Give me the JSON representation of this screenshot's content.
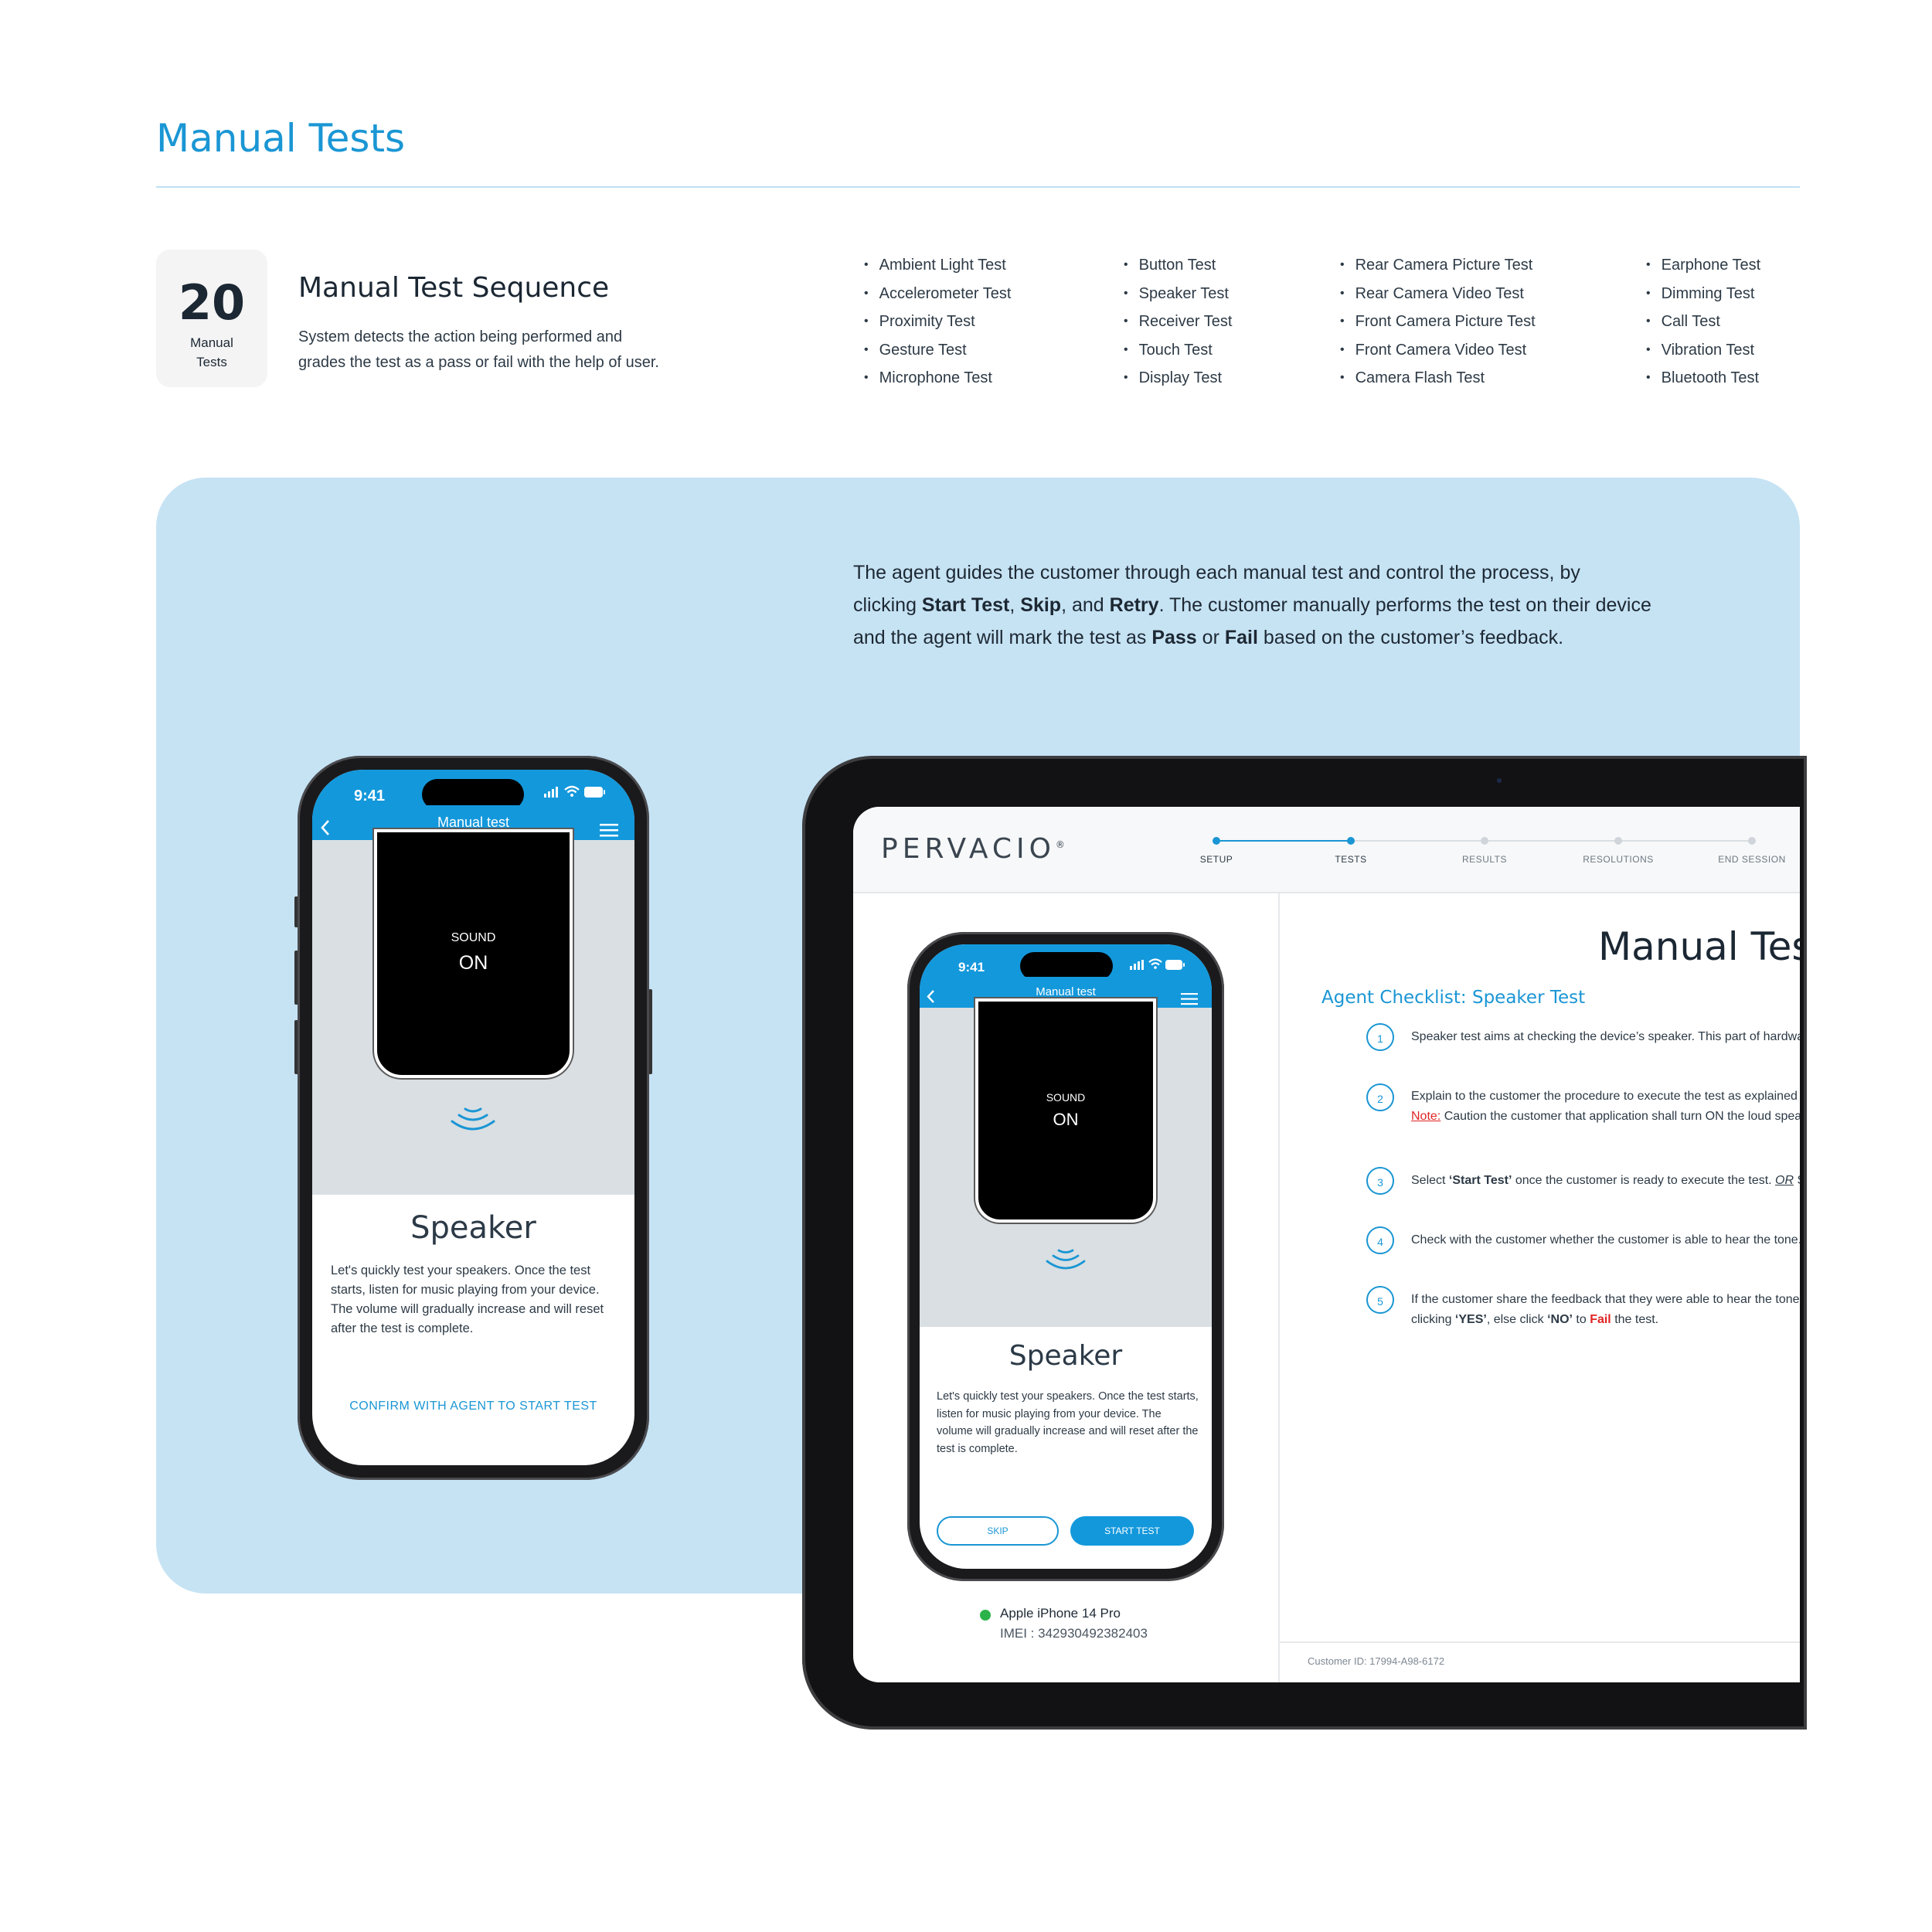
{
  "header": {
    "title": "Manual Tests",
    "count": "20",
    "count_label": "Manual Tests",
    "sequence_title": "Manual Test Sequence",
    "sequence_desc_1": "System detects the action being performed and",
    "sequence_desc_2": "grades the test as a pass or fail with the help of user."
  },
  "tests": {
    "col1": [
      "Ambient Light Test",
      "Accelerometer Test",
      "Proximity Test",
      "Gesture Test",
      "Microphone Test"
    ],
    "col2": [
      "Button Test",
      "Speaker Test",
      "Receiver Test",
      "Touch Test",
      "Display Test"
    ],
    "col3": [
      "Rear Camera Picture Test",
      "Rear Camera Video Test",
      "Front Camera Picture Test",
      "Front Camera Video Test",
      "Camera Flash Test"
    ],
    "col4": [
      "Earphone Test",
      "Dimming Test",
      "Call Test",
      "Vibration Test",
      "Bluetooth Test"
    ]
  },
  "intro": {
    "p1": "The agent guides the customer through each manual test and control the process, by",
    "p2a": "clicking ",
    "p2b": "Start Test",
    "p2c": ", ",
    "p2d": "Skip",
    "p2e": ", and ",
    "p2f": "Retry",
    "p2g": ". The customer manually performs the test on their device",
    "p3a": "and the agent will mark the test as ",
    "p3b": "Pass",
    "p3c": " or ",
    "p3d": "Fail",
    "p3e": " based on the customer’s feedback."
  },
  "phone_customer": {
    "time": "9:41",
    "nav_title": "Manual test",
    "sound_label": "SOUND",
    "sound_state": "ON",
    "test_title": "Speaker",
    "test_desc": "Let's quickly test your speakers. Once the test starts, listen for music playing from your device. The volume will gradually increase and will reset after the test is complete.",
    "cta": "CONFIRM WITH AGENT TO START TEST"
  },
  "agent_app": {
    "logo": "PERVACIO",
    "logo_mark": "®",
    "steps": [
      "SETUP",
      "TESTS",
      "RESULTS",
      "RESOLUTIONS",
      "END SESSION"
    ],
    "active_step_index": 1,
    "phone": {
      "time": "9:41",
      "nav_title": "Manual test",
      "sound_label": "SOUND",
      "sound_state": "ON",
      "test_title": "Speaker",
      "test_desc": "Let's quickly test your speakers. Once the test starts, listen for music playing from your device. The volume will gradually increase and will reset after the test is complete.",
      "skip_label": "SKIP",
      "start_label": "START TEST"
    },
    "device_name": "Apple iPhone 14 Pro",
    "imei_label": "IMEI :",
    "imei": "342930492382403",
    "panel_title": "Manual Test",
    "checklist_title": "Agent Checklist: Speaker Test",
    "checklist": [
      {
        "num": "1",
        "line1": "Speaker test aims at checking the device’s speaker. This part of hardware"
      },
      {
        "num": "2",
        "line1": "Explain to the customer the procedure to execute the test as explained o",
        "note_label": "Note:",
        "note_text": " Caution the customer that application shall turn ON the loud speak"
      },
      {
        "num": "3",
        "pre": "Select ",
        "bold": "‘Start Test’",
        "post": " once the customer is ready to execute the test. ",
        "or": "OR",
        "tail": " Se"
      },
      {
        "num": "4",
        "line1": "Check with the customer whether the customer is able to hear the tone."
      },
      {
        "num": "5",
        "line1": "If the customer share the feedback that they were able to hear the tone c",
        "l2a": "clicking ",
        "l2b": "‘YES’",
        "l2c": ", else click ",
        "l2d": "‘NO’",
        "l2e": " to ",
        "l2f": "Fail",
        "l2g": " the test."
      }
    ],
    "customer_id": "Customer ID: 17994-A98-6172"
  },
  "colors": {
    "accent": "#1a96d4",
    "panel_bg": "#c6e3f4",
    "status_green": "#2bb34a",
    "fail_red": "#e02424"
  }
}
